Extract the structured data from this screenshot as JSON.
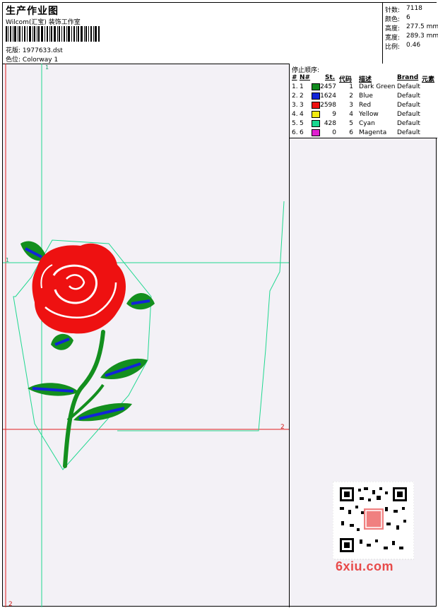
{
  "header": {
    "title": "生产作业图",
    "studio": "Wilcom(汇宝) 装饰工作室",
    "pattern_label": "花版:",
    "pattern_value": "1977633.dst",
    "colorway_label": "色位:",
    "colorway_value": "Colorway 1"
  },
  "stats": [
    {
      "label": "针数:",
      "value": "7118"
    },
    {
      "label": "颜色:",
      "value": "6"
    },
    {
      "label": "高度:",
      "value": "277.5 mm"
    },
    {
      "label": "宽度:",
      "value": "289.3 mm"
    },
    {
      "label": "比例:",
      "value": "0.46"
    }
  ],
  "stop_sequence": {
    "heading": "停止顺序:",
    "columns": {
      "num": "#",
      "n": "N#",
      "st": "St.",
      "code": "代码",
      "desc": "描述",
      "brand": "Brand",
      "elem": "元素"
    },
    "rows": [
      {
        "num": "1.",
        "n": "1",
        "color": "#118a1e",
        "st": "2457",
        "code": "1",
        "desc": "Dark Green",
        "brand": "Default"
      },
      {
        "num": "2.",
        "n": "2",
        "color": "#1224d8",
        "st": "1624",
        "code": "2",
        "desc": "Blue",
        "brand": "Default"
      },
      {
        "num": "3.",
        "n": "3",
        "color": "#ee1111",
        "st": "2598",
        "code": "3",
        "desc": "Red",
        "brand": "Default"
      },
      {
        "num": "4.",
        "n": "4",
        "color": "#f2ea10",
        "st": "9",
        "code": "4",
        "desc": "Yellow",
        "brand": "Default"
      },
      {
        "num": "5.",
        "n": "5",
        "color": "#18d890",
        "st": "428",
        "code": "5",
        "desc": "Cyan",
        "brand": "Default"
      },
      {
        "num": "6.",
        "n": "6",
        "color": "#e020d0",
        "st": "0",
        "code": "6",
        "desc": "Magenta",
        "brand": "Default"
      }
    ]
  },
  "canvas": {
    "markers": {
      "top_1": "1",
      "left_1": "1",
      "right_2": "2",
      "bottom_2": "2"
    }
  },
  "watermark": {
    "site": "6xiu.com"
  }
}
